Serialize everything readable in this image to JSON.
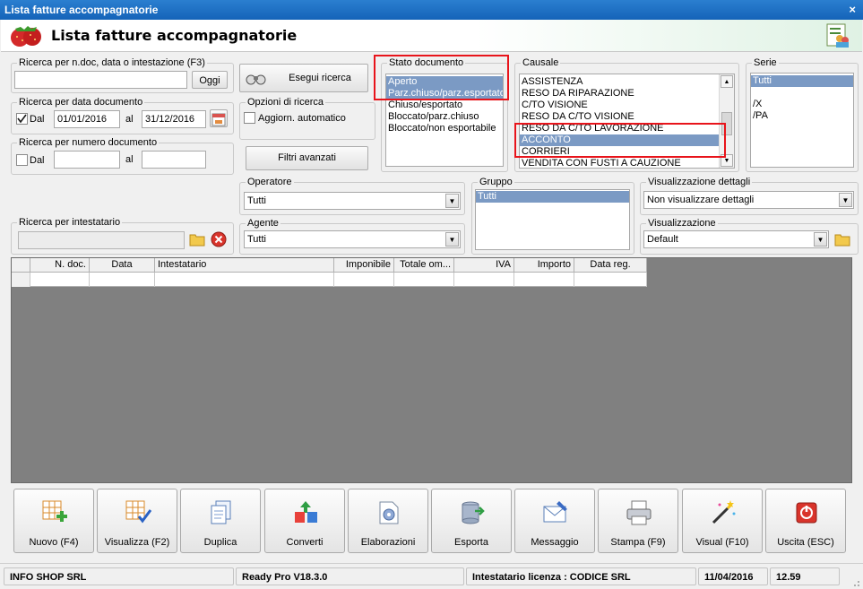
{
  "window": {
    "title": "Lista fatture accompagnatorie",
    "close": "×"
  },
  "header": {
    "title": "Lista fatture accompagnatorie"
  },
  "search_ndoc": {
    "legend": "Ricerca per n.doc, data o intestazione (F3)",
    "value": "",
    "button": "Oggi"
  },
  "search_date": {
    "legend": "Ricerca per data documento",
    "checked": true,
    "dal_label": "Dal",
    "dal_value": "01/01/2016",
    "al_label": "al",
    "al_value": "31/12/2016"
  },
  "search_number": {
    "legend": "Ricerca per numero documento",
    "checked": false,
    "dal_label": "Dal",
    "dal_value": "",
    "al_label": "al",
    "al_value": ""
  },
  "search_holder": {
    "legend": "Ricerca per intestatario",
    "value": ""
  },
  "buttons": {
    "search": "Esegui ricerca",
    "advanced_filters": "Filtri avanzati"
  },
  "search_options": {
    "legend": "Opzioni di ricerca",
    "auto_update_label": "Aggiorn. automatico",
    "checked": false
  },
  "doc_state": {
    "legend": "Stato documento",
    "items": [
      "Aperto",
      "Parz.chiuso/parz.esportato",
      "Chiuso/esportato",
      "Bloccato/parz.chiuso",
      "Bloccato/non esportabile"
    ],
    "selected": [
      0,
      1
    ]
  },
  "causale": {
    "legend": "Causale",
    "items": [
      "ASSISTENZA",
      "RESO DA RIPARAZIONE",
      "C/TO VISIONE",
      "RESO DA C/TO VISIONE",
      "RESO DA C/TO LAVORAZIONE",
      "ACCONTO",
      "CORRIERI",
      "VENDITA CON FUSTI A CAUZIONE"
    ],
    "selected": [
      5
    ]
  },
  "serie": {
    "legend": "Serie",
    "items": [
      "Tutti",
      "",
      "/X",
      "/PA"
    ],
    "selected": [
      0
    ]
  },
  "operatore": {
    "legend": "Operatore",
    "value": "Tutti"
  },
  "agente": {
    "legend": "Agente",
    "value": "Tutti"
  },
  "gruppo": {
    "legend": "Gruppo",
    "items": [
      "Tutti"
    ],
    "selected": [
      0
    ]
  },
  "vis_dettagli": {
    "legend": "Visualizzazione dettagli",
    "value": "Non visualizzare dettagli"
  },
  "visualizzazione": {
    "legend": "Visualizzazione",
    "value": "Default"
  },
  "grid": {
    "columns": [
      "N. doc.",
      "Data",
      "Intestatario",
      "Imponibile",
      "Totale om...",
      "IVA",
      "Importo",
      "Data reg."
    ]
  },
  "actions": [
    {
      "label": "Nuovo (F4)",
      "icon": "new-grid-icon"
    },
    {
      "label": "Visualizza (F2)",
      "icon": "view-grid-icon"
    },
    {
      "label": "Duplica",
      "icon": "duplicate-icon"
    },
    {
      "label": "Converti",
      "icon": "convert-icon"
    },
    {
      "label": "Elaborazioni",
      "icon": "process-icon"
    },
    {
      "label": "Esporta",
      "icon": "export-icon"
    },
    {
      "label": "Messaggio",
      "icon": "message-icon"
    },
    {
      "label": "Stampa (F9)",
      "icon": "printer-icon"
    },
    {
      "label": "Visual (F10)",
      "icon": "magic-wand-icon"
    },
    {
      "label": "Uscita (ESC)",
      "icon": "exit-icon"
    }
  ],
  "statusbar": {
    "company": "INFO SHOP SRL",
    "version": "Ready Pro V18.3.0",
    "license": "Intestatario licenza : CODICE SRL",
    "date": "11/04/2016",
    "time": "12.59"
  },
  "colors": {
    "titlebar": "#1d6fc4",
    "selection": "#7b9ac4",
    "highlight_box": "#e8141b",
    "grid_bg": "#808080"
  }
}
